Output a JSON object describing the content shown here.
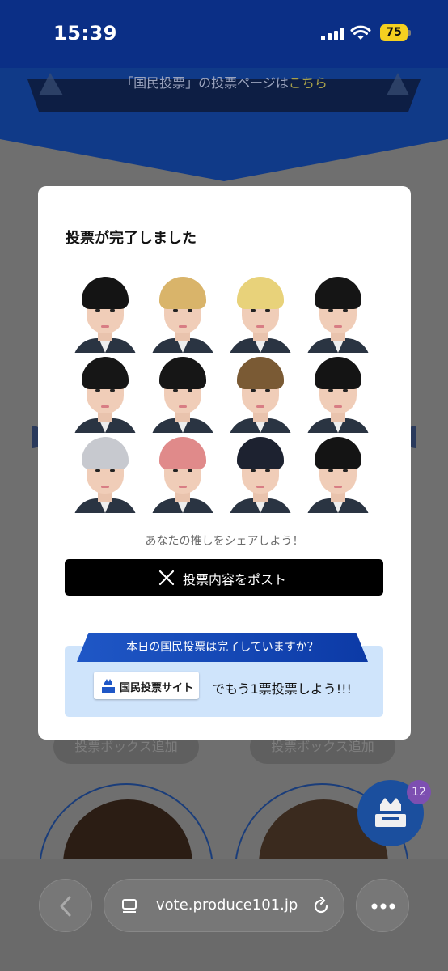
{
  "status_bar": {
    "time": "15:39",
    "battery": "75"
  },
  "banner": {
    "text": "「国民投票」の投票ページは",
    "link": "こちら"
  },
  "background": {
    "vote_box_left": "投票ボックス追加",
    "vote_box_right": "投票ボックス追加",
    "fab_badge": "12"
  },
  "modal": {
    "title": "投票が完了しました",
    "share_caption": "あなたの推しをシェアしよう！",
    "post_button": "投票内容をポスト",
    "promo": {
      "ribbon": "本日の国民投票は完了していますか？",
      "site_chip": "国民投票サイト",
      "text": "でもう1票投票しよう!!!"
    },
    "trainees": [
      {
        "hair": "#141414"
      },
      {
        "hair": "#d9b46a"
      },
      {
        "hair": "#e8d27a"
      },
      {
        "hair": "#151515"
      },
      {
        "hair": "#161616"
      },
      {
        "hair": "#161616"
      },
      {
        "hair": "#7a5a34"
      },
      {
        "hair": "#141414"
      },
      {
        "hair": "#c7c9cf"
      },
      {
        "hair": "#e08a8a"
      },
      {
        "hair": "#1d2230"
      },
      {
        "hair": "#141414"
      }
    ]
  },
  "browser": {
    "url": "vote.produce101.jp"
  },
  "colors": {
    "status_bar": "#0b2f86",
    "promo_bg": "#cfe4fb",
    "ribbon": "#1f57c6",
    "fab": "#1b4f9e"
  }
}
